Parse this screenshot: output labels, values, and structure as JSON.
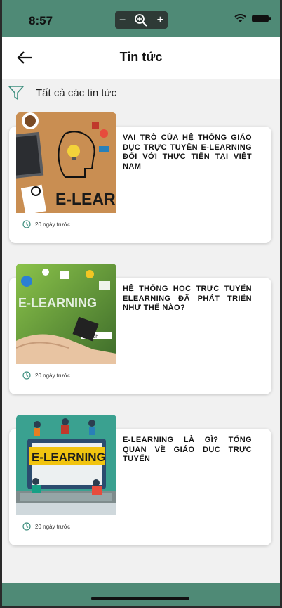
{
  "status_bar": {
    "time": "8:57"
  },
  "zoom": {
    "minus": "−",
    "plus": "+"
  },
  "header": {
    "title": "Tin tức"
  },
  "filter": {
    "label": "Tất cả các tin tức"
  },
  "articles": [
    {
      "title": "VAI TRÒ CỦA HỆ THỐNG GIÁO DỤC TRỰC TUYẾN E-LEARNING ĐỐI VỚI THỰC TIỄN TẠI VIỆT NAM",
      "time": "20 ngày trước",
      "image_text": "E-LEARN"
    },
    {
      "title": "HỆ THỐNG HỌC TRỰC TUYẾN ELEARNING ĐÃ PHÁT TRIỂN NHƯ THẾ NÀO?",
      "time": "20 ngày trước",
      "image_text": "E-LEARNING",
      "image_search": "Search"
    },
    {
      "title": "E-LEARNING LÀ GÌ? TỔNG QUAN VỀ GIÁO DỤC TRỰC TUYẾN",
      "time": "20 ngày trước",
      "image_text": "E-LEARNING"
    }
  ],
  "colors": {
    "brand_green": "#4f8a76",
    "accent_teal": "#3f8f7f"
  }
}
